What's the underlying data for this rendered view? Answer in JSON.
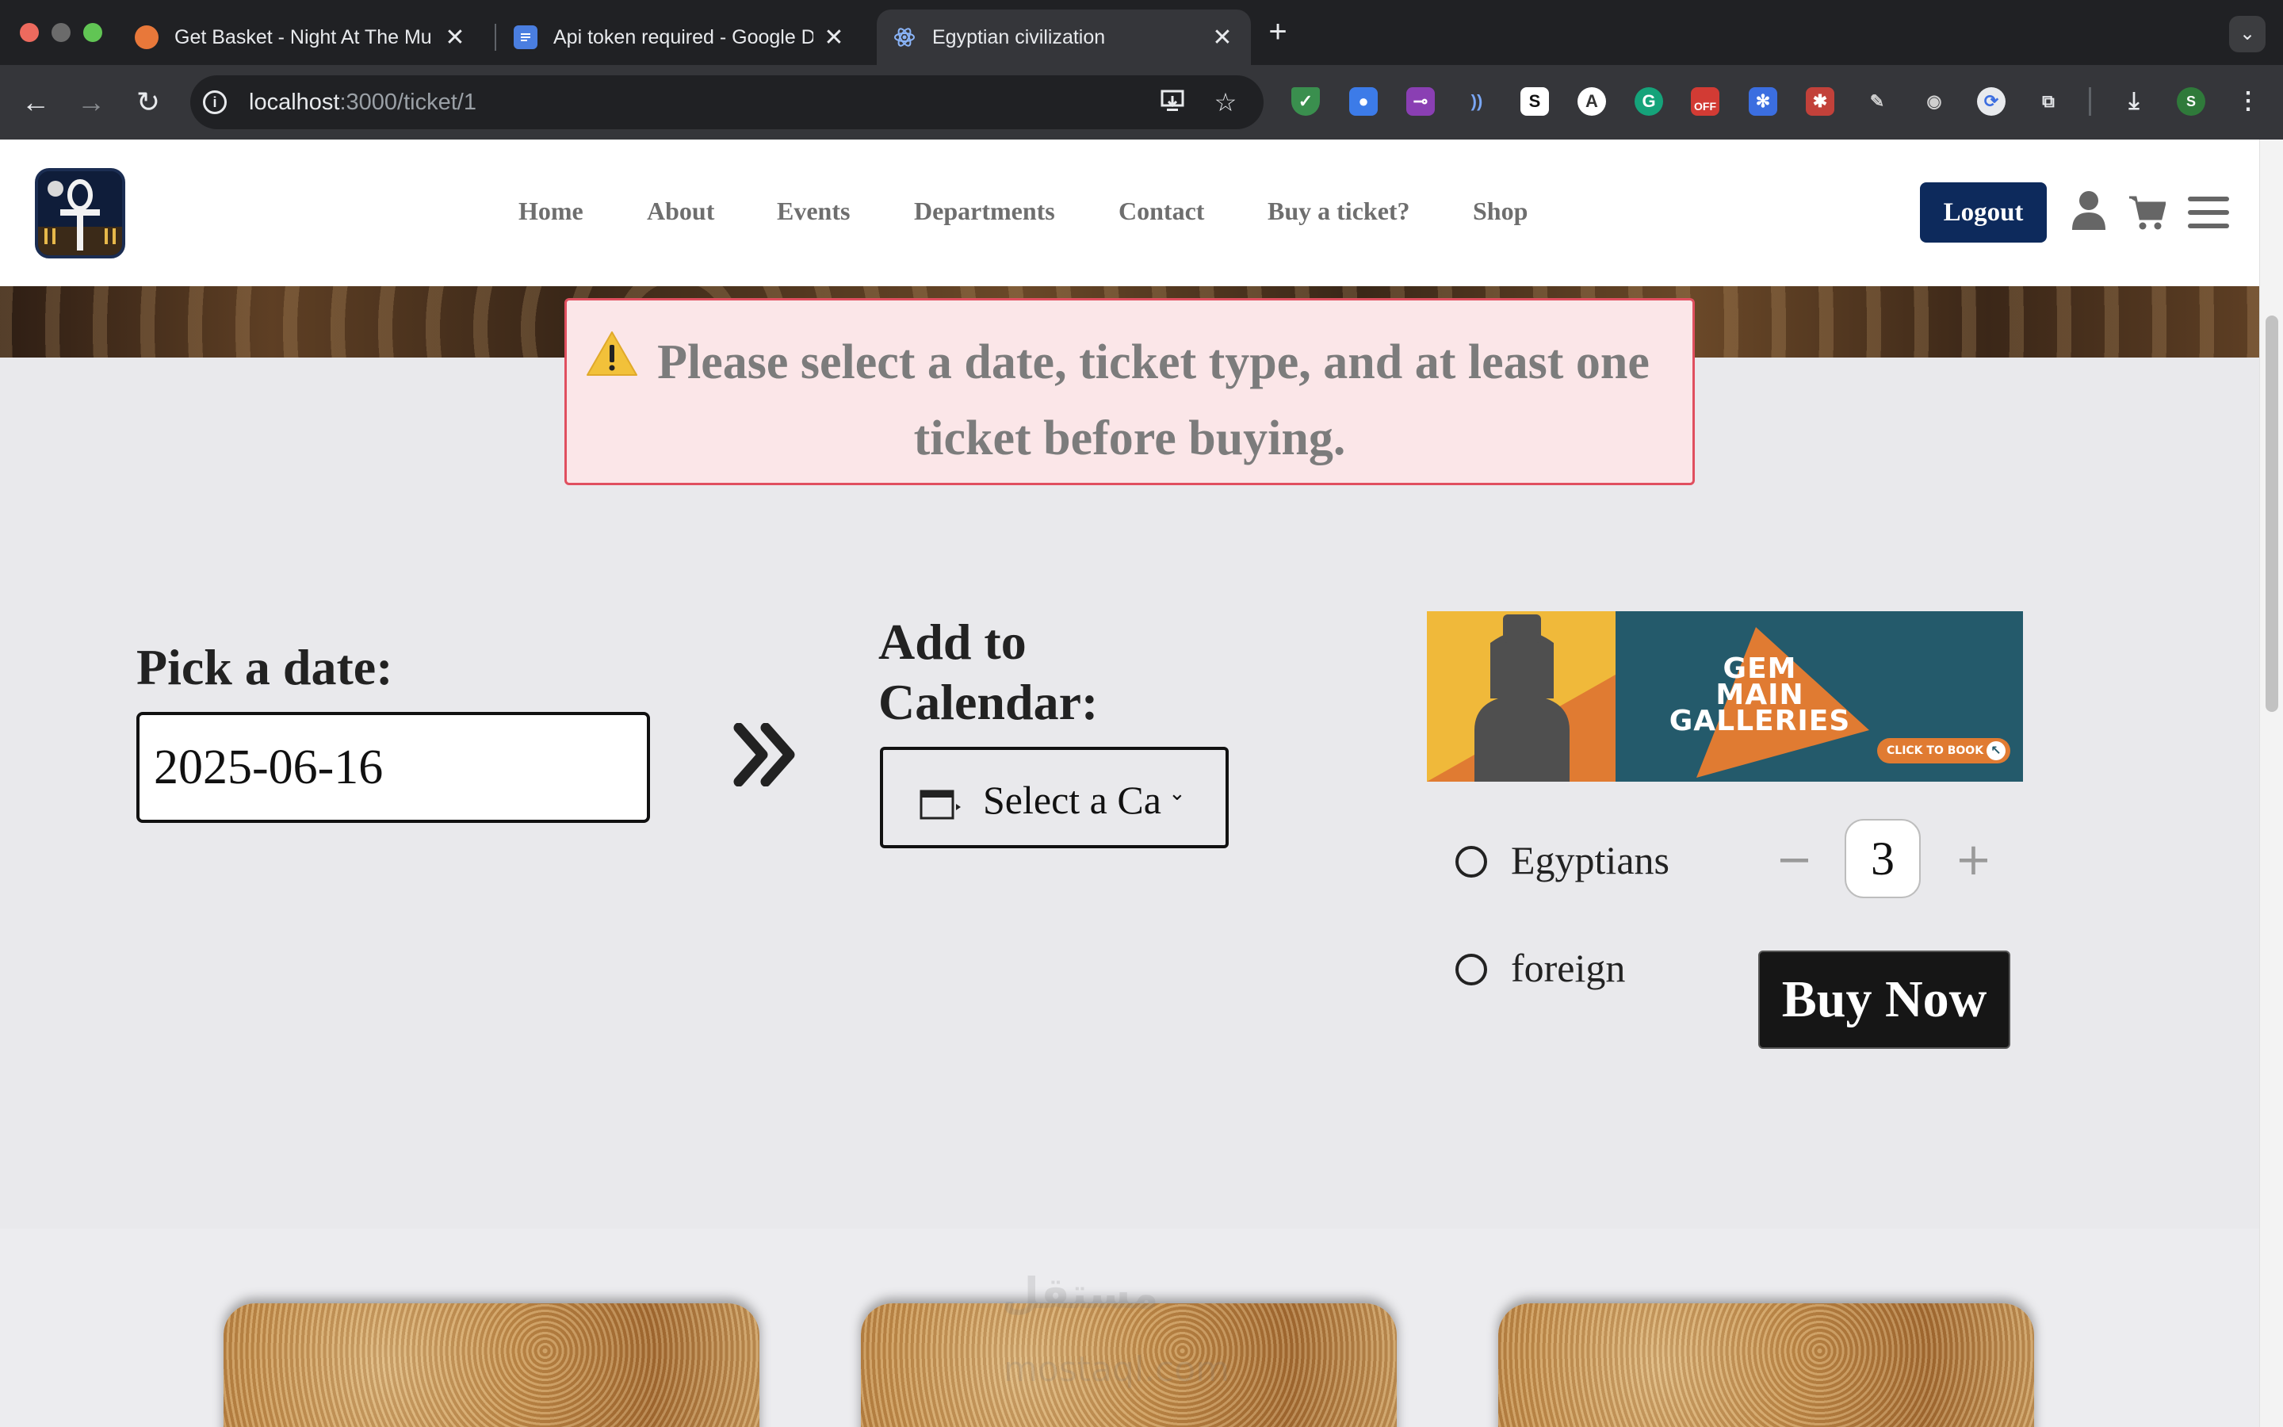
{
  "browser": {
    "tabs": [
      {
        "title": "Get Basket - Night At The Mu",
        "active": false
      },
      {
        "title": "Api token required - Google D",
        "active": false
      },
      {
        "title": "Egyptian civilization",
        "active": true
      }
    ],
    "url_host": "localhost",
    "url_path": ":3000/ticket/1",
    "extensions": [
      "shield-ext",
      "drop-ext",
      "slider-ext",
      "wave-ext",
      "s-ext",
      "a-ext",
      "grammarly-ext",
      "off-ext",
      "snowflake-ext",
      "bug-ext",
      "pen-ext",
      "camera-ext",
      "sync-ext",
      "puzzle-ext"
    ],
    "extension_off_badge": "OFF",
    "profile_initial": "S"
  },
  "site": {
    "nav": [
      "Home",
      "About",
      "Events",
      "Departments",
      "Contact",
      "Buy a ticket?",
      "Shop"
    ],
    "logout_label": "Logout"
  },
  "alert": {
    "line1": "Please select a date, ticket type, and at least one",
    "line2": "ticket before buying."
  },
  "booking": {
    "date_label": "Pick a date:",
    "date_value": "2025-06-16",
    "calendar_label_line1": "Add to",
    "calendar_label_line2": "Calendar:",
    "calendar_select": "Select a Ca",
    "banner": {
      "title_line1": "GEM",
      "title_line2": "MAIN",
      "title_line3": "GALLERIES",
      "cta": "CLICK TO BOOK"
    },
    "ticket_types": [
      "Egyptians",
      "foreign"
    ],
    "quantity": "3",
    "buy_label": "Buy Now"
  },
  "watermark": {
    "line1": "مستقل",
    "line2": "mostaql.com"
  },
  "colors": {
    "header_button": "#0d2a5c",
    "alert_bg": "#fbe6e8",
    "alert_border": "#e04f5f",
    "buy_button": "#161616"
  }
}
